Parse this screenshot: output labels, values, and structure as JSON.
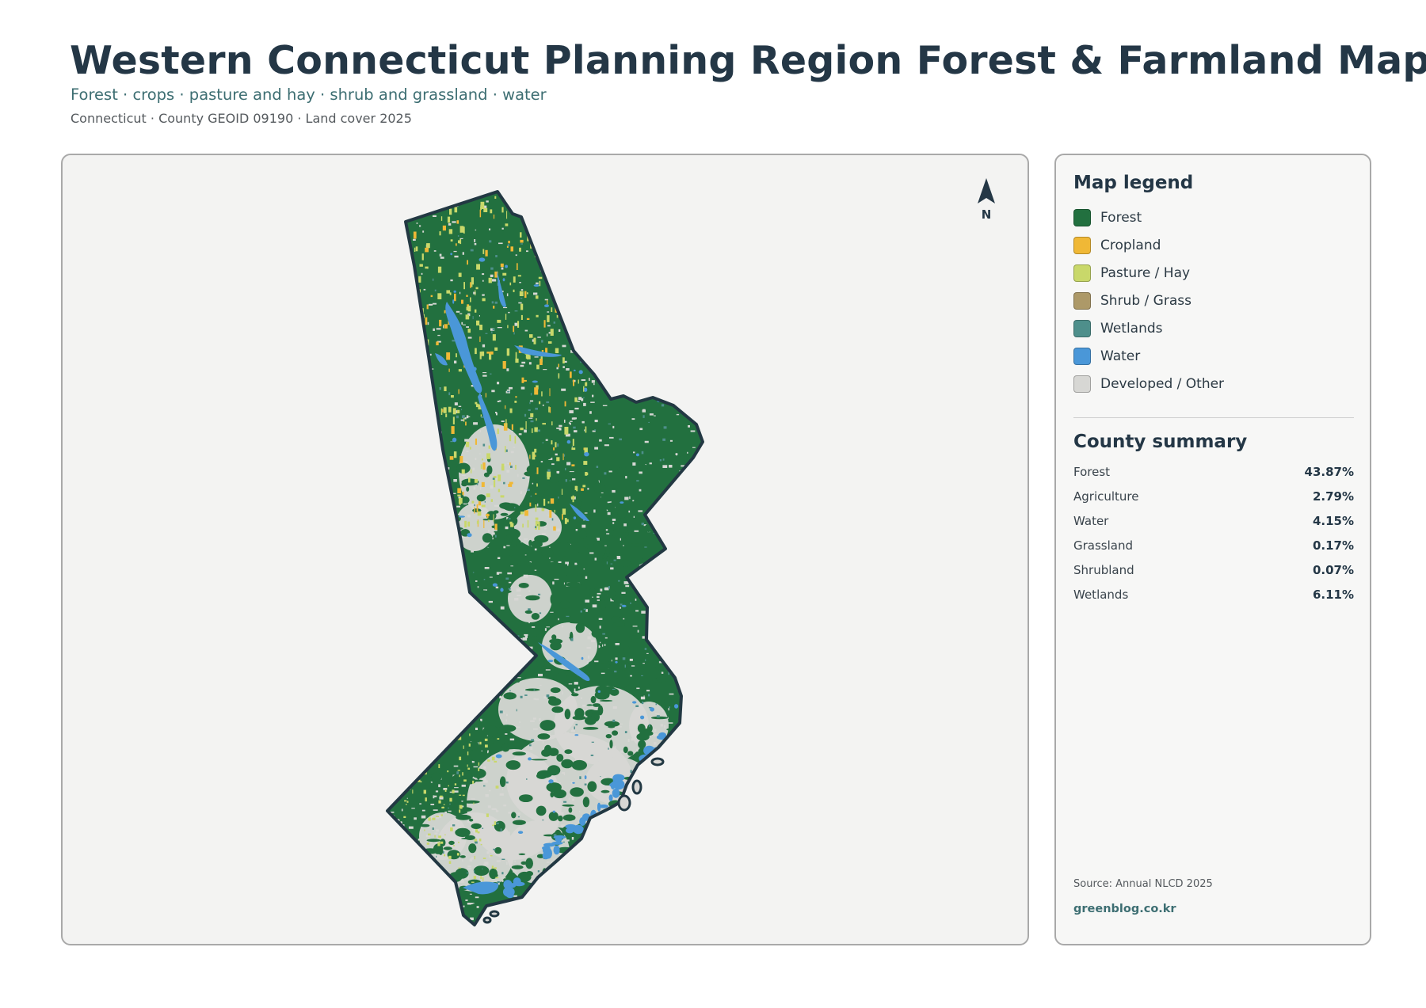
{
  "header": {
    "title": "Western Connecticut Planning Region Forest & Farmland Map",
    "subtitle": "Forest · crops · pasture and hay · shrub and grassland · water",
    "meta": "Connecticut · County GEOID 09190 · Land cover 2025"
  },
  "map": {
    "north_label": "N",
    "colors": {
      "forest": "#22703f",
      "cropland": "#f0b836",
      "pasture": "#c9d86a",
      "shrub": "#ad9968",
      "wetlands": "#4e8f8b",
      "water": "#4a97d8",
      "developed": "#d7d7d4",
      "outline": "#223843"
    }
  },
  "legend": {
    "heading": "Map legend",
    "items": [
      {
        "label": "Forest",
        "color": "#22703f"
      },
      {
        "label": "Cropland",
        "color": "#f0b836"
      },
      {
        "label": "Pasture / Hay",
        "color": "#c9d86a"
      },
      {
        "label": "Shrub / Grass",
        "color": "#ad9968"
      },
      {
        "label": "Wetlands",
        "color": "#4e8f8b"
      },
      {
        "label": "Water",
        "color": "#4a97d8"
      },
      {
        "label": "Developed / Other",
        "color": "#d7d7d4"
      }
    ]
  },
  "summary": {
    "heading": "County summary",
    "rows": [
      {
        "label": "Forest",
        "value": "43.87%"
      },
      {
        "label": "Agriculture",
        "value": "2.79%"
      },
      {
        "label": "Water",
        "value": "4.15%"
      },
      {
        "label": "Grassland",
        "value": "0.17%"
      },
      {
        "label": "Shrubland",
        "value": "0.07%"
      },
      {
        "label": "Wetlands",
        "value": "6.11%"
      }
    ]
  },
  "footer": {
    "source": "Source: Annual NLCD 2025",
    "site": "greenblog.co.kr"
  }
}
